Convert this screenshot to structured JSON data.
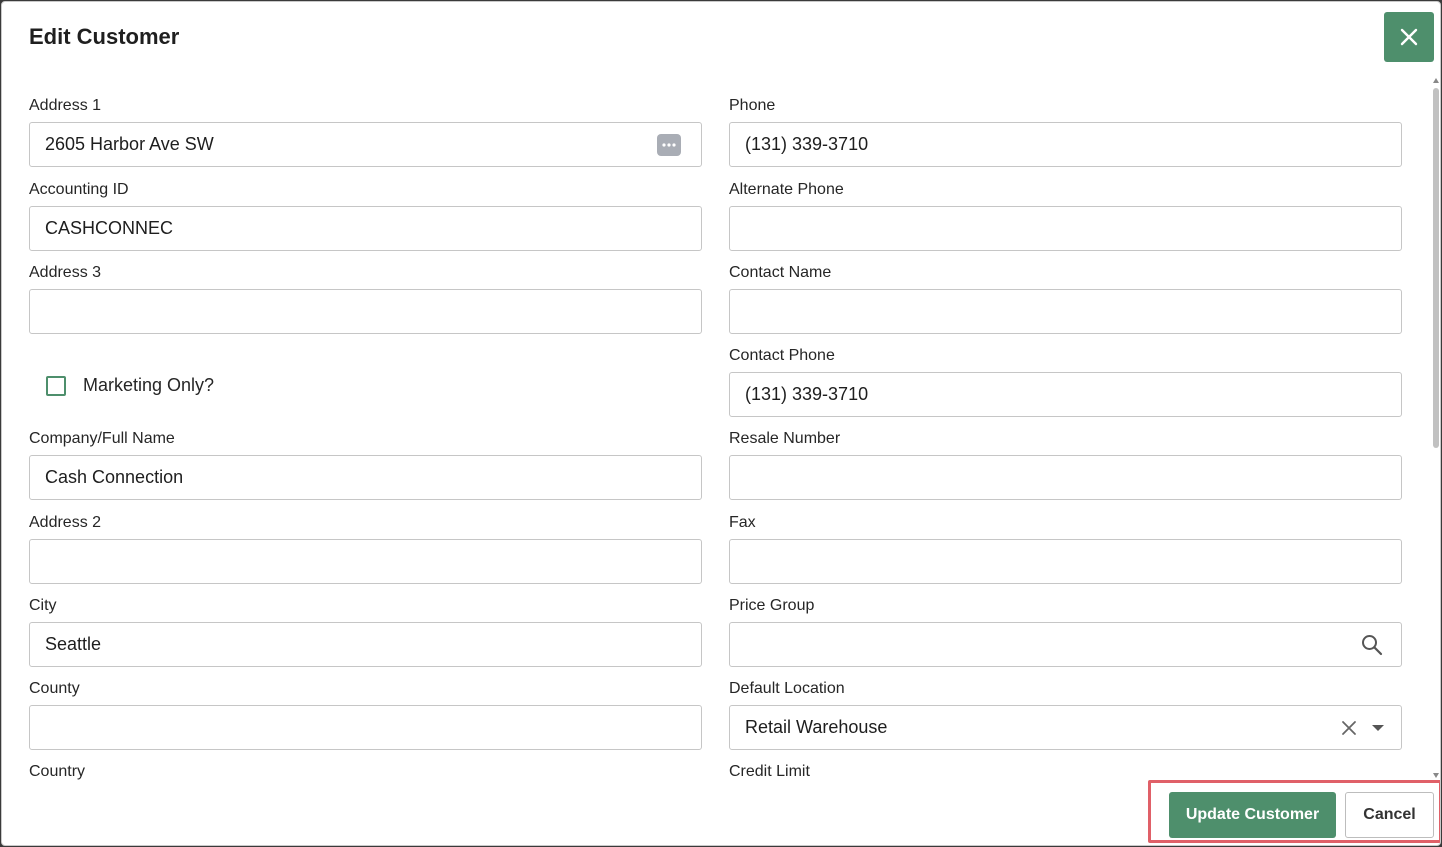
{
  "dialog": {
    "title": "Edit Customer",
    "close_icon": "close-icon"
  },
  "left": {
    "address1": {
      "label": "Address 1",
      "value": "2605 Harbor Ave SW",
      "icon": "more-options-icon"
    },
    "accounting_id": {
      "label": "Accounting ID",
      "value": "CASHCONNEC"
    },
    "address3": {
      "label": "Address 3",
      "value": ""
    },
    "marketing_only": {
      "label": "Marketing Only?",
      "checked": false
    },
    "company": {
      "label": "Company/Full Name",
      "value": "Cash Connection"
    },
    "address2": {
      "label": "Address 2",
      "value": ""
    },
    "city": {
      "label": "City",
      "value": "Seattle"
    },
    "county": {
      "label": "County",
      "value": ""
    },
    "country": {
      "label": "Country"
    }
  },
  "right": {
    "phone": {
      "label": "Phone",
      "value": "(131) 339-3710"
    },
    "alternate_phone": {
      "label": "Alternate Phone",
      "value": ""
    },
    "contact_name": {
      "label": "Contact Name",
      "value": ""
    },
    "contact_phone": {
      "label": "Contact Phone",
      "value": "(131) 339-3710"
    },
    "resale_number": {
      "label": "Resale Number",
      "value": ""
    },
    "fax": {
      "label": "Fax",
      "value": ""
    },
    "price_group": {
      "label": "Price Group",
      "value": "",
      "icon": "search-icon"
    },
    "default_location": {
      "label": "Default Location",
      "value": "Retail Warehouse",
      "icons": [
        "clear-icon",
        "chevron-down-icon"
      ]
    },
    "credit_limit": {
      "label": "Credit Limit"
    }
  },
  "footer": {
    "update_label": "Update Customer",
    "cancel_label": "Cancel"
  },
  "colors": {
    "accent": "#4e8f6c",
    "highlight": "#e06068"
  }
}
